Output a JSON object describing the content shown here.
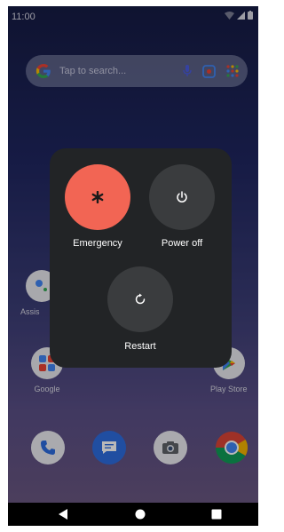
{
  "status_bar": {
    "time": "11:00"
  },
  "search": {
    "placeholder": "Tap to search..."
  },
  "home_apps": [
    {
      "label": "Assis"
    },
    {
      "label": "Google"
    },
    {
      "label": "Play Store"
    }
  ],
  "power_menu": {
    "emergency_label": "Emergency",
    "power_off_label": "Power off",
    "restart_label": "Restart",
    "colors": {
      "emergency": "#f26554",
      "button": "#3a3c3e",
      "panel": "#222426"
    }
  },
  "dock": {
    "icons": [
      "phone-icon",
      "messages-icon",
      "camera-icon",
      "chrome-icon"
    ]
  },
  "nav": {
    "icons": [
      "back-icon",
      "home-icon",
      "recents-icon"
    ]
  }
}
